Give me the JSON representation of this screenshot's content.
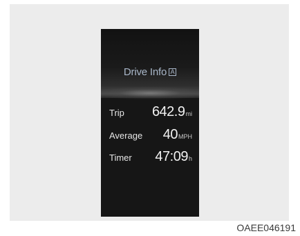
{
  "display": {
    "title": "Drive Info",
    "badge": "A",
    "rows": [
      {
        "label": "Trip",
        "value": "642.9",
        "unit": "mi"
      },
      {
        "label": "Average",
        "value": "40",
        "unit": "MPH"
      },
      {
        "label": "Timer",
        "value": "47:09",
        "unit": "h"
      }
    ]
  },
  "figure_code": "OAEE046191",
  "colors": {
    "display_bg": "#161616",
    "title_text": "#a9b7c9",
    "value_text": "#f2f2f2",
    "frame_bg": "#ececec"
  }
}
